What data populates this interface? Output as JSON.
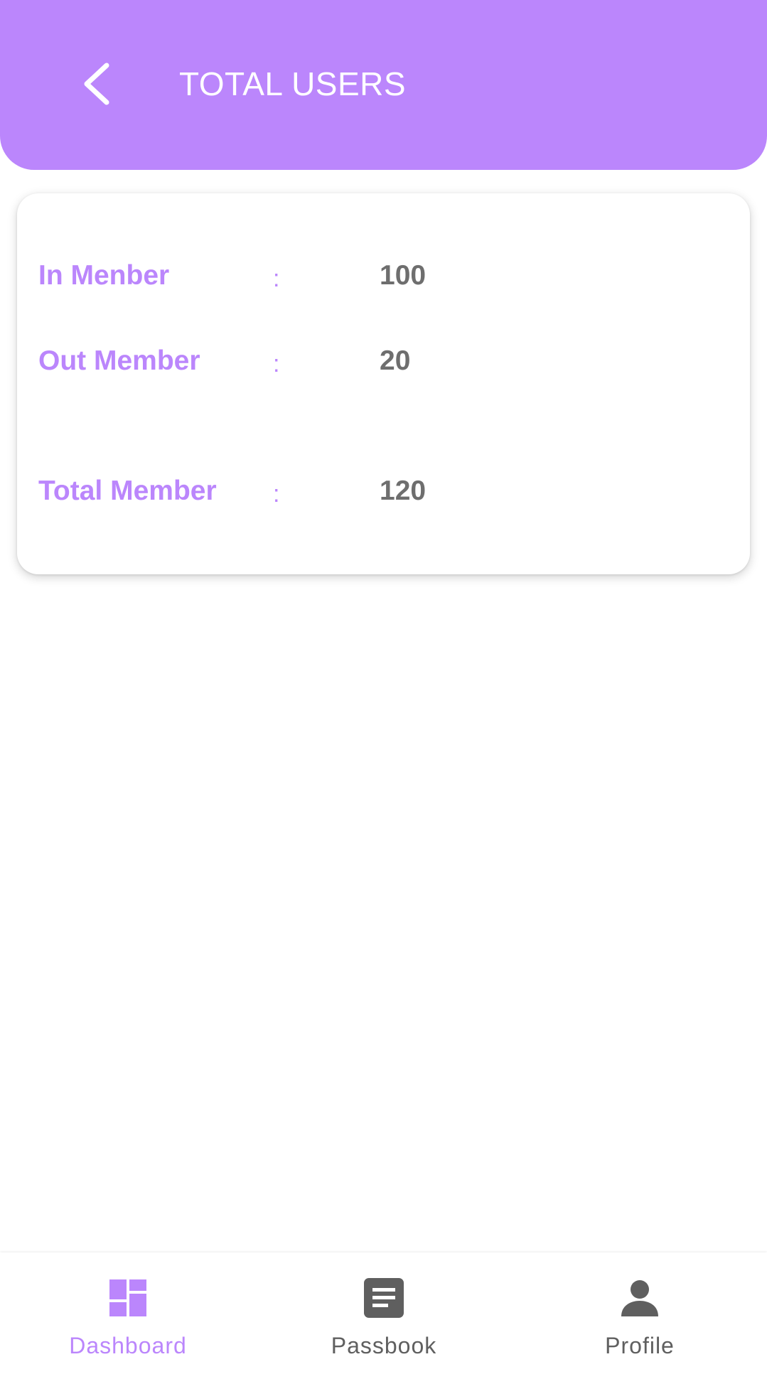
{
  "header": {
    "title": "TOTAL USERS",
    "back_icon": "chevron-left-icon"
  },
  "stats": {
    "in_member": {
      "label": "In Menber",
      "separator": ":",
      "value": "100"
    },
    "out_member": {
      "label": "Out Member",
      "separator": ":",
      "value": "20"
    },
    "total_member": {
      "label": "Total Member",
      "separator": ":",
      "value": "120"
    }
  },
  "bottom_nav": {
    "items": [
      {
        "label": "Dashboard",
        "icon": "dashboard-icon",
        "active": true
      },
      {
        "label": "Passbook",
        "icon": "passbook-icon",
        "active": false
      },
      {
        "label": "Profile",
        "icon": "person-icon",
        "active": false
      }
    ]
  },
  "colors": {
    "accent": "#BB86FC",
    "value_text": "#6E6E6E",
    "nav_inactive": "#5F5F5F",
    "background": "#FFFFFF"
  }
}
